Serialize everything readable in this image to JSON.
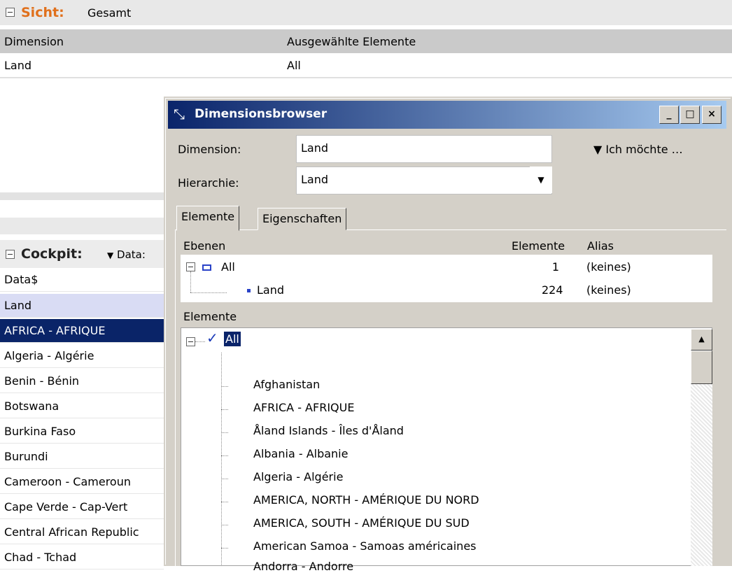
{
  "sicht": {
    "title": "Sicht:",
    "value": "Gesamt",
    "col_dimension": "Dimension",
    "col_selected": "Ausgewählte Elemente",
    "row_dimension": "Land",
    "row_selected": "All"
  },
  "cockpit": {
    "title": "Cockpit:",
    "data_label": "Data:",
    "items": [
      "Data$",
      "Land",
      "AFRICA - AFRIQUE",
      "Algeria - Algérie",
      "Benin - Bénin",
      "Botswana",
      "Burkina Faso",
      "Burundi",
      "Cameroon - Cameroun",
      "Cape Verde - Cap-Vert",
      "Central African Republic",
      "Chad - Tchad"
    ]
  },
  "dialog": {
    "title": "Dimensionsbrowser",
    "btn_minimize": "_",
    "btn_maximize": "□",
    "btn_close": "×",
    "dimension_label": "Dimension:",
    "dimension_value": "Land",
    "hierarchie_label": "Hierarchie:",
    "hierarchie_value": "Land",
    "ich_moechte": "▼ Ich möchte …",
    "tab_elemente": "Elemente",
    "tab_eigenschaften": "Eigenschaften",
    "ebenen_header": "Ebenen",
    "elemente_header": "Elemente",
    "alias_header": "Alias",
    "levels": [
      {
        "name": "All",
        "count": "1",
        "alias": "(keines)"
      },
      {
        "name": "Land",
        "count": "224",
        "alias": "(keines)"
      }
    ],
    "elemente_section": "Elemente",
    "tree_root": "All",
    "tree_items": [
      "Afghanistan",
      "AFRICA - AFRIQUE",
      "Åland Islands - Îles d'Åland",
      "Albania - Albanie",
      "Algeria - Algérie",
      "AMERICA, NORTH - AMÉRIQUE DU NORD",
      "AMERICA, SOUTH - AMÉRIQUE DU SUD",
      "American Samoa - Samoas américaines",
      "Andorra - Andorre"
    ]
  }
}
